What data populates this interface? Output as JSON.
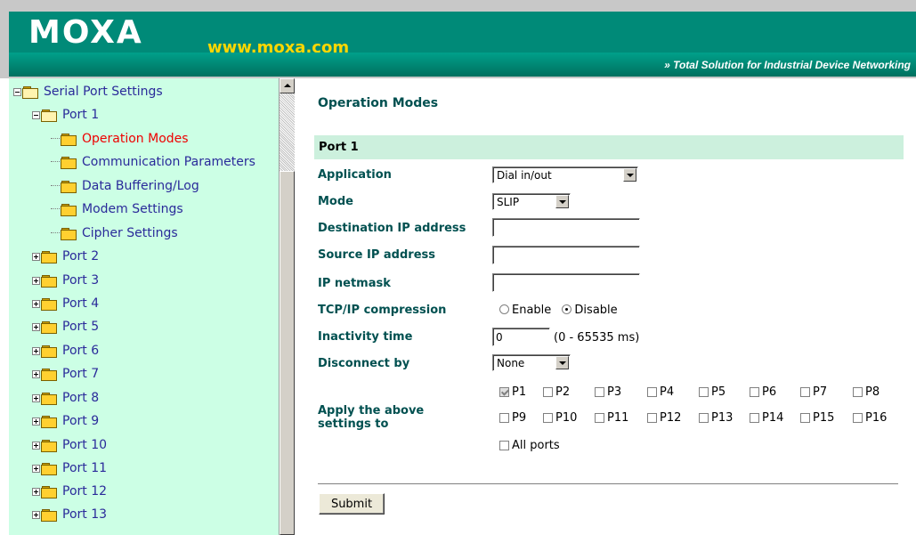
{
  "header": {
    "logo": "MOXA",
    "website": "www.moxa.com",
    "tagline": "» Total Solution for Industrial Device Networking"
  },
  "sidebar": {
    "root": "Serial Port Settings",
    "port1": "Port 1",
    "port1_children": [
      {
        "label": "Operation Modes",
        "active": true
      },
      {
        "label": "Communication Parameters"
      },
      {
        "label": "Data Buffering/Log"
      },
      {
        "label": "Modem Settings"
      },
      {
        "label": "Cipher Settings"
      }
    ],
    "ports": [
      "Port 2",
      "Port 3",
      "Port 4",
      "Port 5",
      "Port 6",
      "Port 7",
      "Port 8",
      "Port 9",
      "Port 10",
      "Port 11",
      "Port 12",
      "Port 13"
    ]
  },
  "main": {
    "title": "Operation Modes",
    "section": "Port 1",
    "labels": {
      "application": "Application",
      "mode": "Mode",
      "dest_ip": "Destination IP address",
      "source_ip": "Source IP address",
      "netmask": "IP netmask",
      "compression": "TCP/IP compression",
      "inactivity": "Inactivity time",
      "disconnect": "Disconnect by",
      "apply": "Apply the above settings to"
    },
    "values": {
      "application": "Dial in/out",
      "mode": "SLIP",
      "dest_ip": "",
      "source_ip": "",
      "netmask": "",
      "inactivity": "0",
      "inactivity_range": "(0 - 65535 ms)",
      "disconnect": "None"
    },
    "compression": {
      "enable": "Enable",
      "disable": "Disable",
      "selected": "Disable"
    },
    "apply_ports_row1": [
      "P1",
      "P2",
      "P3",
      "P4",
      "P5",
      "P6",
      "P7",
      "P8"
    ],
    "apply_ports_row2": [
      "P9",
      "P10",
      "P11",
      "P12",
      "P13",
      "P14",
      "P15",
      "P16"
    ],
    "all_ports": "All ports",
    "checked": [
      "P1"
    ],
    "submit": "Submit"
  },
  "colors": {
    "brand": "#008a78",
    "sidebar_bg": "#ccffe5",
    "label": "#005050",
    "section_bg": "#ccf0dd",
    "active_item": "#ee0000",
    "tree_text": "#2a2a9a"
  }
}
